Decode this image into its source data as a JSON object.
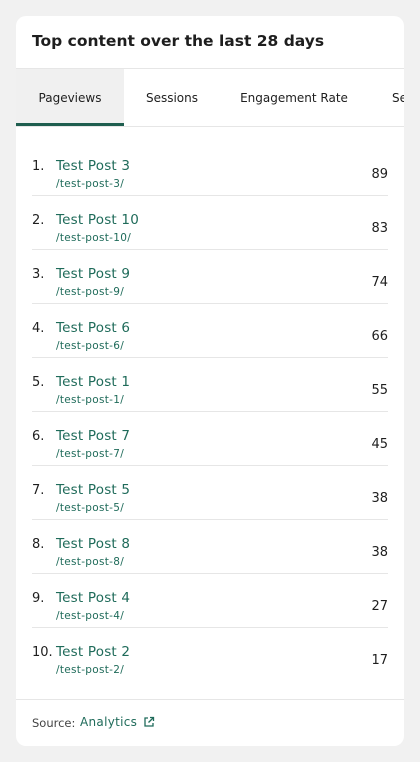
{
  "card": {
    "title": "Top content over the last 28 days"
  },
  "tabs": [
    {
      "label": "Pageviews",
      "active": true
    },
    {
      "label": "Sessions",
      "active": false
    },
    {
      "label": "Engagement Rate",
      "active": false
    },
    {
      "label": "Se",
      "active": false
    }
  ],
  "rows": [
    {
      "rank": "1.",
      "title": "Test Post 3",
      "path": "/test-post-3/",
      "value": "89"
    },
    {
      "rank": "2.",
      "title": "Test Post 10",
      "path": "/test-post-10/",
      "value": "83"
    },
    {
      "rank": "3.",
      "title": "Test Post 9",
      "path": "/test-post-9/",
      "value": "74"
    },
    {
      "rank": "4.",
      "title": "Test Post 6",
      "path": "/test-post-6/",
      "value": "66"
    },
    {
      "rank": "5.",
      "title": "Test Post 1",
      "path": "/test-post-1/",
      "value": "55"
    },
    {
      "rank": "6.",
      "title": "Test Post 7",
      "path": "/test-post-7/",
      "value": "45"
    },
    {
      "rank": "7.",
      "title": "Test Post 5",
      "path": "/test-post-5/",
      "value": "38"
    },
    {
      "rank": "8.",
      "title": "Test Post 8",
      "path": "/test-post-8/",
      "value": "38"
    },
    {
      "rank": "9.",
      "title": "Test Post 4",
      "path": "/test-post-4/",
      "value": "27"
    },
    {
      "rank": "10.",
      "title": "Test Post 2",
      "path": "/test-post-2/",
      "value": "17"
    }
  ],
  "footer": {
    "source_label": "Source:",
    "source_link": "Analytics",
    "link_icon": "external-link-icon"
  },
  "colors": {
    "accent": "#1f6b5a",
    "tab_indicator": "#1f5e4f",
    "active_tab_bg": "#f0f0f0",
    "page_bg": "#f1f1f1",
    "card_bg": "#ffffff"
  }
}
